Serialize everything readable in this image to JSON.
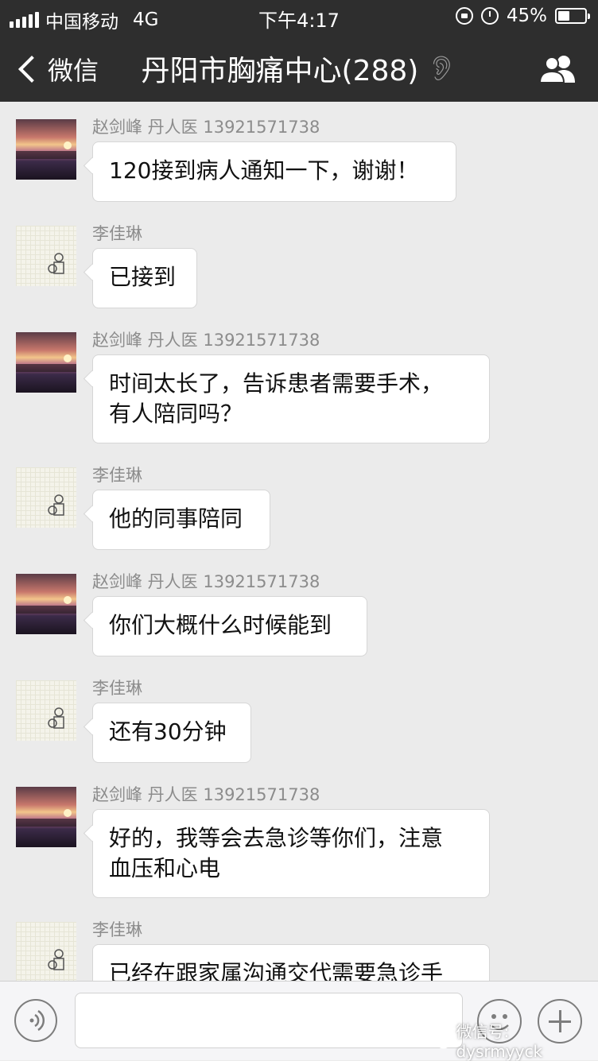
{
  "status_bar": {
    "carrier": "中国移动",
    "network": "4G",
    "time": "下午4:17",
    "battery_percent": "45%",
    "battery_level": 0.45
  },
  "nav": {
    "back_label": "微信",
    "title": "丹阳市胸痛中心(288)",
    "icons": [
      "chevron-left-icon",
      "ear-icon",
      "group-members-icon"
    ]
  },
  "messages": [
    {
      "sender": "赵剑峰 丹人医 13921571738",
      "text": "120接到病人通知一下，谢谢！",
      "avatar": "sunset-avatar"
    },
    {
      "sender": "李佳琳",
      "text": "已接到",
      "avatar": "figure-avatar"
    },
    {
      "sender": "赵剑峰 丹人医 13921571738",
      "text": "时间太长了，告诉患者需要手术，\n有人陪同吗？",
      "avatar": "sunset-avatar"
    },
    {
      "sender": "李佳琳",
      "text": "他的同事陪同",
      "avatar": "figure-avatar"
    },
    {
      "sender": "赵剑峰 丹人医 13921571738",
      "text": "你们大概什么时候能到",
      "avatar": "sunset-avatar"
    },
    {
      "sender": "李佳琳",
      "text": "还有30分钟",
      "avatar": "figure-avatar"
    },
    {
      "sender": "赵剑峰 丹人医 13921571738",
      "text": "好的，我等会去急诊等你们，注意\n血压和心电",
      "avatar": "sunset-avatar"
    },
    {
      "sender": "李佳琳",
      "text": "已经在跟家属沟通交代需要急诊手",
      "avatar": "figure-avatar"
    }
  ],
  "input_bar": {
    "icons": [
      "voice-icon",
      "emoji-icon",
      "plus-icon"
    ],
    "text_value": ""
  },
  "watermark": {
    "text": "微信号: dysrmyyck"
  }
}
